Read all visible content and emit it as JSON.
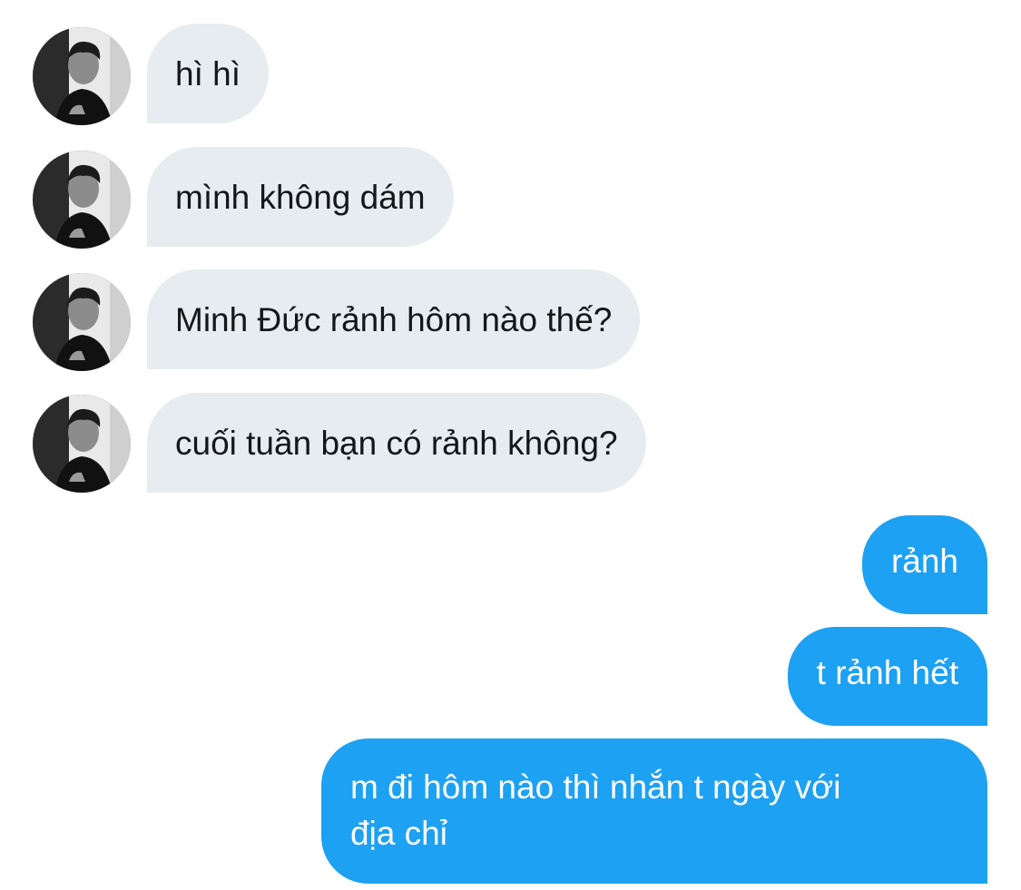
{
  "conversation": {
    "contact_avatar_icon": "user-avatar-icon",
    "incoming_bubble_color": "#e6ecf0",
    "outgoing_bubble_color": "#1da1f2",
    "incoming": [
      {
        "text": "hì hì"
      },
      {
        "text": "mình không dám"
      },
      {
        "text": "Minh Đức rảnh hôm nào thế?"
      },
      {
        "text": "cuối tuần bạn có rảnh không?"
      }
    ],
    "outgoing": [
      {
        "text": "rảnh"
      },
      {
        "text": "t rảnh hết"
      },
      {
        "line1": "m đi hôm nào thì nhắn t ngày với",
        "line2": "địa chỉ"
      }
    ]
  }
}
